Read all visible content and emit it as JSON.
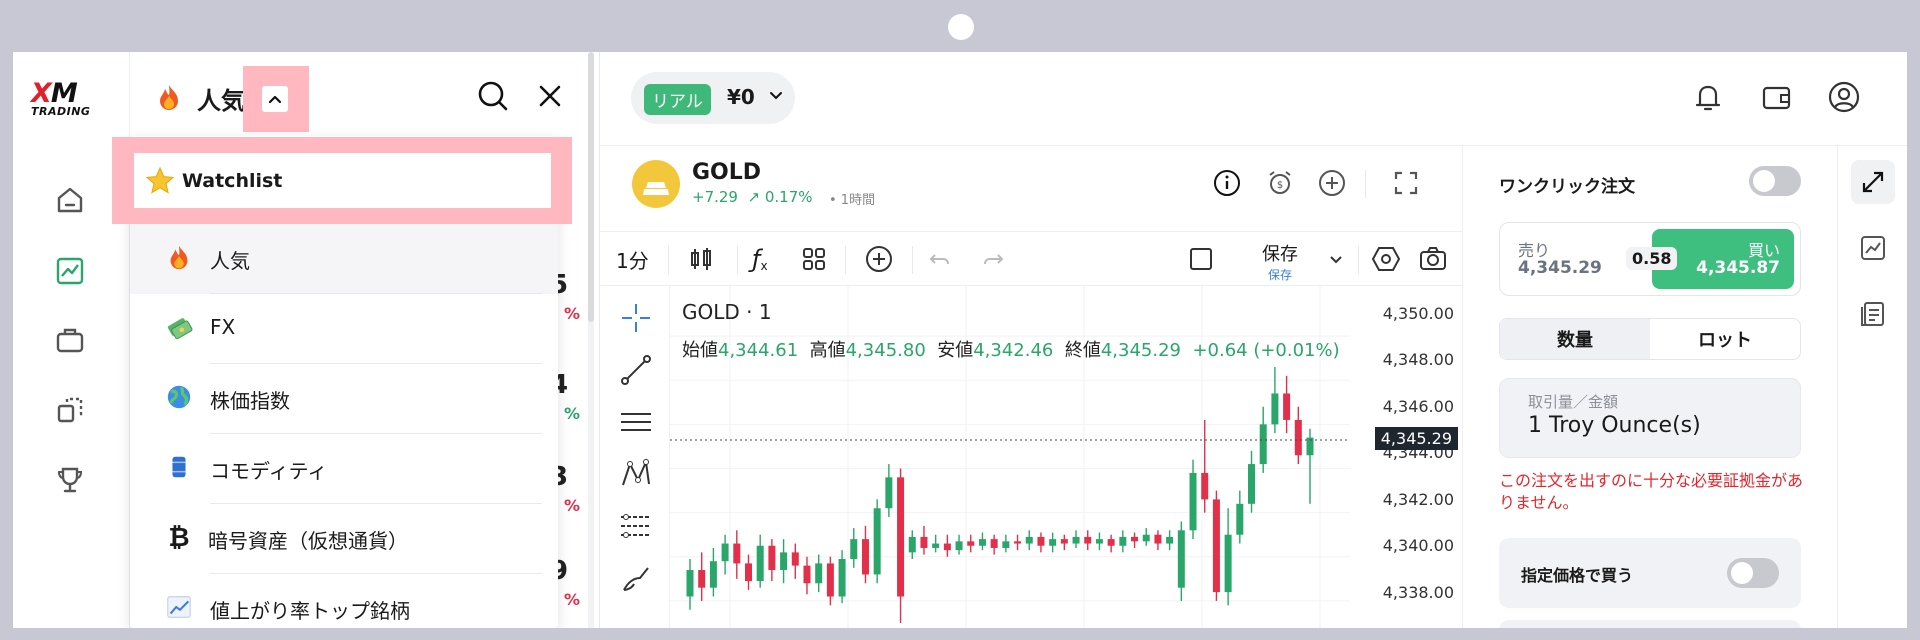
{
  "brand": {
    "logo_mark": "XM",
    "logo_sub": "TRADING"
  },
  "rail": {
    "items": [
      {
        "name": "home-icon"
      },
      {
        "name": "chart-icon"
      },
      {
        "name": "briefcase-icon"
      },
      {
        "name": "copy-icon"
      },
      {
        "name": "trophy-icon"
      }
    ]
  },
  "panel": {
    "title": "人気",
    "behind_values": [
      "5",
      "4",
      "3",
      "9"
    ],
    "behind_pcts": [
      "%",
      "%",
      "%",
      "%"
    ]
  },
  "dropdown": {
    "items": [
      {
        "label": "Watchlist",
        "icon": "star-icon"
      },
      {
        "label": "人気",
        "icon": "flame-icon"
      },
      {
        "label": "FX",
        "icon": "money-icon"
      },
      {
        "label": "株価指数",
        "icon": "globe-icon"
      },
      {
        "label": "コモディティ",
        "icon": "barrel-icon"
      },
      {
        "label": "暗号資産（仮想通貨）",
        "icon": "bitcoin-icon"
      },
      {
        "label": "値上がり率トップ銘柄",
        "icon": "trend-up-icon"
      }
    ]
  },
  "account": {
    "type_badge": "リアル",
    "balance": "¥0"
  },
  "symbol": {
    "name": "GOLD",
    "change": "+7.29",
    "change_pct": "0.17%",
    "timeframe": "• 1時間"
  },
  "toolbar": {
    "interval": "1分",
    "save_label": "保存",
    "save_sub": "保存"
  },
  "chart_header": {
    "title": "GOLD · 1",
    "open_label": "始値",
    "open": "4,344.61",
    "high_label": "高値",
    "high": "4,345.80",
    "low_label": "安値",
    "low": "4,342.46",
    "close_label": "終値",
    "close": "4,345.29",
    "change": "+0.64 (+0.01%)",
    "price_axis": [
      "4,350.00",
      "4,348.00",
      "4,346.00",
      "4,344.00",
      "4,342.00",
      "4,340.00",
      "4,338.00"
    ],
    "current_price": "4,345.29"
  },
  "chart_data": {
    "type": "candlestick",
    "title": "GOLD · 1",
    "ylim": [
      4337.0,
      4351.0
    ],
    "current": 4345.29,
    "candles": [
      {
        "o": 4338.2,
        "c": 4339.4,
        "h": 4339.9,
        "l": 4337.6
      },
      {
        "o": 4339.4,
        "c": 4338.6,
        "h": 4340.2,
        "l": 4338.0
      },
      {
        "o": 4338.6,
        "c": 4339.8,
        "h": 4340.4,
        "l": 4338.2
      },
      {
        "o": 4339.8,
        "c": 4340.6,
        "h": 4341.0,
        "l": 4339.2
      },
      {
        "o": 4340.6,
        "c": 4339.7,
        "h": 4341.2,
        "l": 4339.0
      },
      {
        "o": 4339.7,
        "c": 4338.9,
        "h": 4340.1,
        "l": 4338.5
      },
      {
        "o": 4338.9,
        "c": 4340.5,
        "h": 4341.0,
        "l": 4338.6
      },
      {
        "o": 4340.5,
        "c": 4339.4,
        "h": 4340.8,
        "l": 4338.9
      },
      {
        "o": 4339.4,
        "c": 4340.2,
        "h": 4340.8,
        "l": 4338.8
      },
      {
        "o": 4340.2,
        "c": 4339.6,
        "h": 4340.6,
        "l": 4339.0
      },
      {
        "o": 4339.6,
        "c": 4338.8,
        "h": 4340.0,
        "l": 4338.3
      },
      {
        "o": 4338.8,
        "c": 4339.7,
        "h": 4340.1,
        "l": 4338.4
      },
      {
        "o": 4339.7,
        "c": 4338.2,
        "h": 4340.0,
        "l": 4337.8
      },
      {
        "o": 4338.2,
        "c": 4339.9,
        "h": 4340.3,
        "l": 4337.9
      },
      {
        "o": 4339.9,
        "c": 4340.8,
        "h": 4341.3,
        "l": 4339.5
      },
      {
        "o": 4340.8,
        "c": 4339.2,
        "h": 4341.4,
        "l": 4338.8
      },
      {
        "o": 4339.2,
        "c": 4342.2,
        "h": 4342.6,
        "l": 4338.8
      },
      {
        "o": 4342.2,
        "c": 4343.6,
        "h": 4344.2,
        "l": 4341.8
      },
      {
        "o": 4343.6,
        "c": 4338.2,
        "h": 4344.0,
        "l": 4337.0
      },
      {
        "o": 4340.2,
        "c": 4340.9,
        "h": 4341.2,
        "l": 4339.9
      },
      {
        "o": 4340.9,
        "c": 4340.4,
        "h": 4341.4,
        "l": 4340.1
      },
      {
        "o": 4340.4,
        "c": 4340.6,
        "h": 4341.0,
        "l": 4340.2
      },
      {
        "o": 4340.6,
        "c": 4340.3,
        "h": 4341.0,
        "l": 4340.0
      },
      {
        "o": 4340.3,
        "c": 4340.7,
        "h": 4341.0,
        "l": 4340.1
      },
      {
        "o": 4340.7,
        "c": 4340.5,
        "h": 4341.0,
        "l": 4340.2
      },
      {
        "o": 4340.5,
        "c": 4340.8,
        "h": 4341.1,
        "l": 4340.3
      },
      {
        "o": 4340.8,
        "c": 4340.4,
        "h": 4341.0,
        "l": 4340.1
      },
      {
        "o": 4340.4,
        "c": 4340.7,
        "h": 4341.0,
        "l": 4340.2
      },
      {
        "o": 4340.7,
        "c": 4340.6,
        "h": 4341.0,
        "l": 4340.3
      },
      {
        "o": 4340.6,
        "c": 4340.9,
        "h": 4341.2,
        "l": 4340.3
      },
      {
        "o": 4340.9,
        "c": 4340.5,
        "h": 4341.1,
        "l": 4340.2
      },
      {
        "o": 4340.5,
        "c": 4340.8,
        "h": 4341.1,
        "l": 4340.2
      },
      {
        "o": 4340.8,
        "c": 4340.6,
        "h": 4341.0,
        "l": 4340.3
      },
      {
        "o": 4340.6,
        "c": 4340.9,
        "h": 4341.2,
        "l": 4340.4
      },
      {
        "o": 4340.9,
        "c": 4340.6,
        "h": 4341.2,
        "l": 4340.3
      },
      {
        "o": 4340.6,
        "c": 4340.8,
        "h": 4341.1,
        "l": 4340.3
      },
      {
        "o": 4340.8,
        "c": 4340.5,
        "h": 4341.0,
        "l": 4340.2
      },
      {
        "o": 4340.5,
        "c": 4340.9,
        "h": 4341.2,
        "l": 4340.2
      },
      {
        "o": 4340.9,
        "c": 4340.7,
        "h": 4341.1,
        "l": 4340.4
      },
      {
        "o": 4340.7,
        "c": 4341.0,
        "h": 4341.3,
        "l": 4340.5
      },
      {
        "o": 4341.0,
        "c": 4340.6,
        "h": 4341.2,
        "l": 4340.3
      },
      {
        "o": 4340.6,
        "c": 4340.9,
        "h": 4341.2,
        "l": 4340.3
      },
      {
        "o": 4338.6,
        "c": 4341.2,
        "h": 4341.6,
        "l": 4338.0
      },
      {
        "o": 4341.2,
        "c": 4343.8,
        "h": 4344.4,
        "l": 4340.8
      },
      {
        "o": 4343.8,
        "c": 4342.6,
        "h": 4346.2,
        "l": 4342.0
      },
      {
        "o": 4342.6,
        "c": 4338.4,
        "h": 4343.0,
        "l": 4338.0
      },
      {
        "o": 4338.4,
        "c": 4341.0,
        "h": 4342.2,
        "l": 4337.8
      },
      {
        "o": 4341.0,
        "c": 4342.4,
        "h": 4343.0,
        "l": 4340.6
      },
      {
        "o": 4342.4,
        "c": 4344.2,
        "h": 4344.8,
        "l": 4342.0
      },
      {
        "o": 4344.2,
        "c": 4346.0,
        "h": 4346.8,
        "l": 4343.8
      },
      {
        "o": 4346.0,
        "c": 4347.4,
        "h": 4348.6,
        "l": 4345.6
      },
      {
        "o": 4347.4,
        "c": 4346.2,
        "h": 4348.2,
        "l": 4345.6
      },
      {
        "o": 4346.2,
        "c": 4344.6,
        "h": 4346.8,
        "l": 4344.2
      },
      {
        "o": 4344.6,
        "c": 4345.4,
        "h": 4345.8,
        "l": 4342.4
      }
    ]
  },
  "order": {
    "one_click_label": "ワンクリック注文",
    "sell_label": "売り",
    "sell_price": "4,345.29",
    "buy_label": "買い",
    "buy_price": "4,345.87",
    "spread": "0.58",
    "tab_qty": "数量",
    "tab_lot": "ロット",
    "qty_label": "取引量／金額",
    "qty_value": "1 Troy Ounce(s)",
    "warning": "この注文を出すのに十分な必要証拠金がありません。",
    "limit_label": "指定価格で買う"
  },
  "colors": {
    "up": "#2aa66a",
    "down": "#e2304a",
    "accent": "#3fb979",
    "highlight": "#ffb8bf"
  }
}
